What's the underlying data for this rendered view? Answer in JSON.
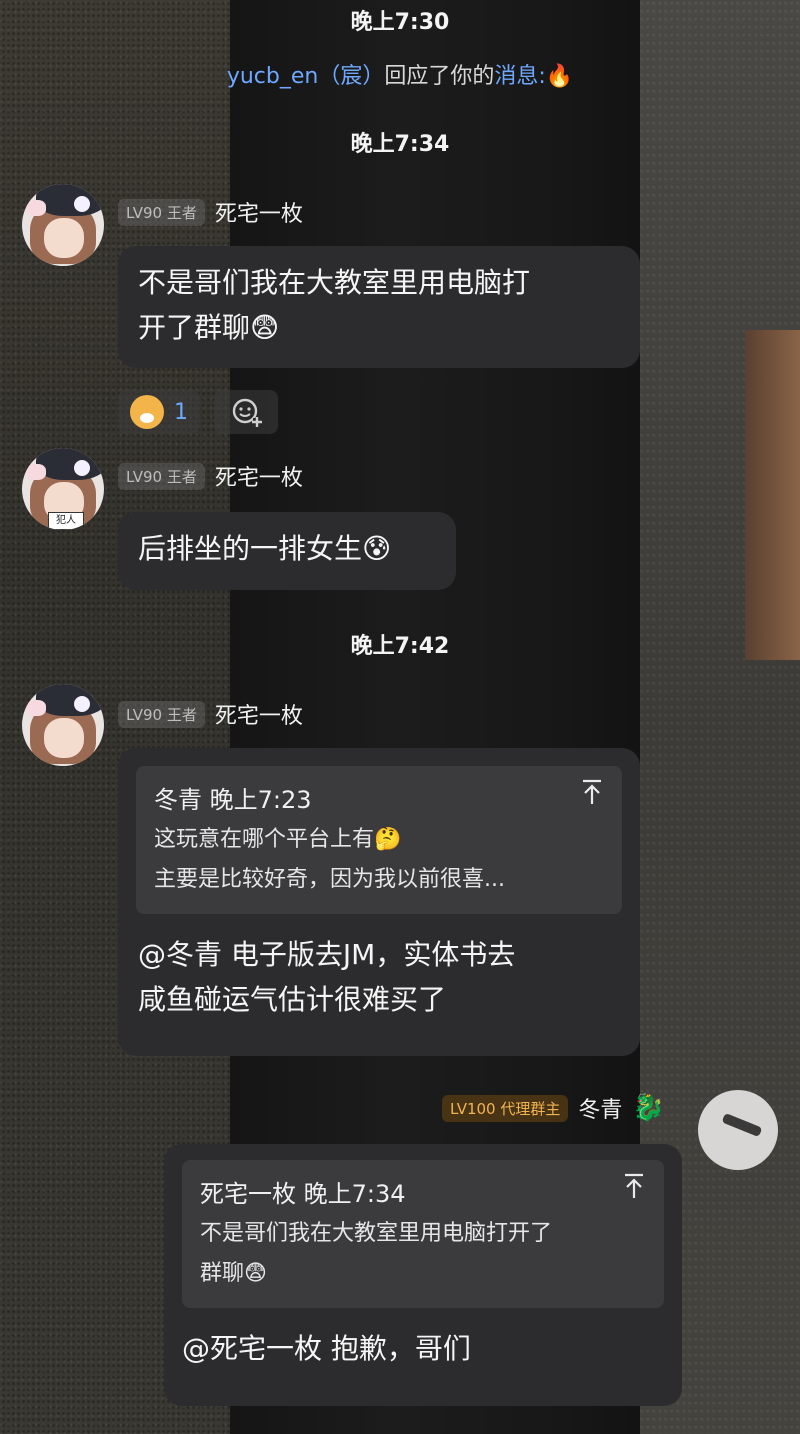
{
  "times": [
    "晚上7:30",
    "晚上7:34",
    "晚上7:42"
  ],
  "notice": {
    "user": "yucb_en（宸）",
    "text": "回应了你的",
    "link": "消息:",
    "emoji": "🔥"
  },
  "messages": [
    {
      "level": "LV90 王者",
      "name": "死宅一枚",
      "text_line1": "不是哥们我在大教室里用电脑打",
      "text_line2": "开了群聊😨"
    },
    {
      "level": "LV90 王者",
      "name": "死宅一枚",
      "avatar_tag": "犯人",
      "text": "后排坐的一排女生😰"
    },
    {
      "level": "LV90 王者",
      "name": "死宅一枚",
      "quote_author": "冬青",
      "quote_time": "晚上7:23",
      "quote_line1": "这玩意在哪个平台上有🤔",
      "quote_line2": "主要是比较好奇，因为我以前很喜...",
      "text_line1": "@冬青 电子版去JM，实体书去",
      "text_line2": "咸鱼碰运气估计很难买了"
    },
    {
      "level": "LV100 代理群主",
      "name": "冬青",
      "name_emoji": "🐉",
      "quote_author": "死宅一枚",
      "quote_time": "晚上7:34",
      "quote_line1": "不是哥们我在大教室里用电脑打开了",
      "quote_line2": "群聊😨",
      "text": "@死宅一枚 抱歉，哥们"
    }
  ],
  "reaction": {
    "count": "1",
    "add_icon": "emoji-add-icon"
  },
  "icons": {
    "jump": "arrow-up-to-line-icon"
  }
}
